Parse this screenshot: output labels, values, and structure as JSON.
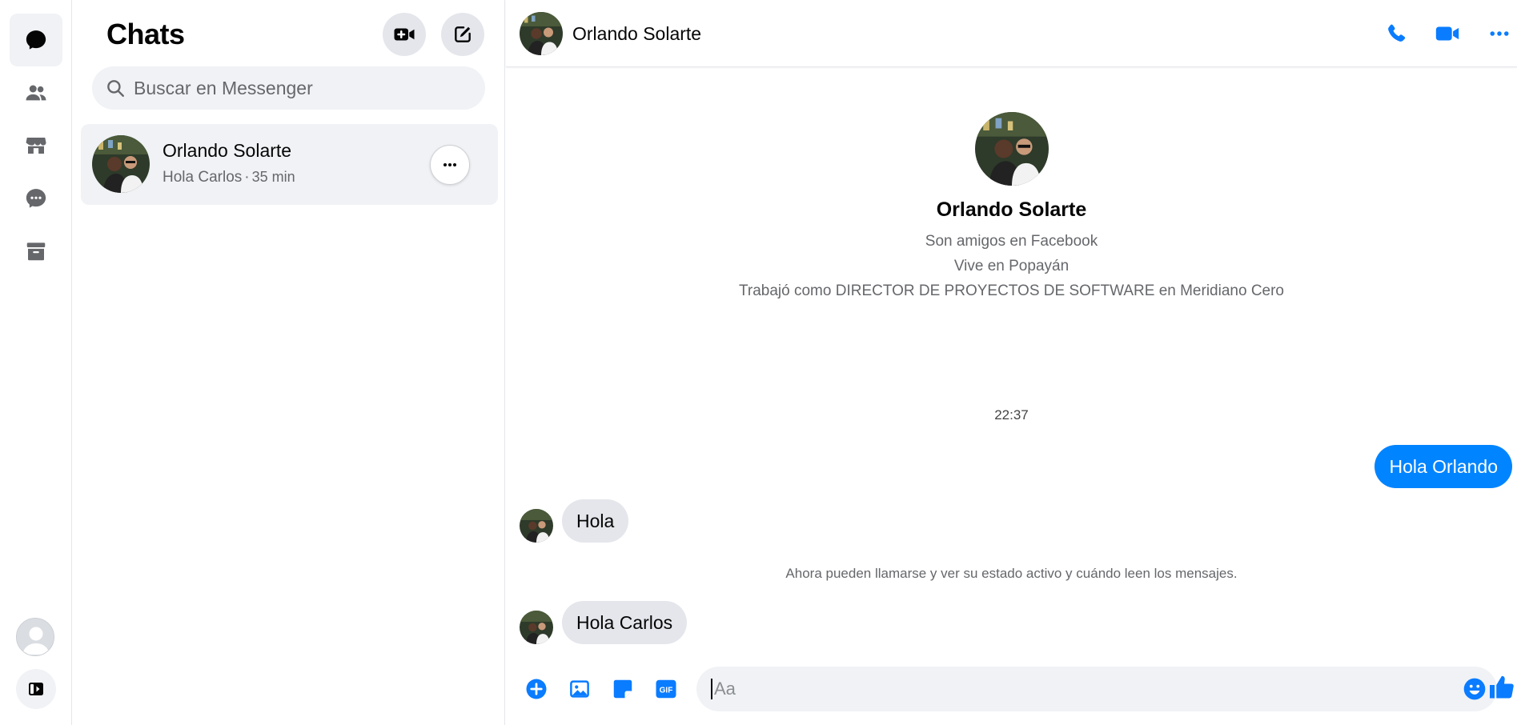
{
  "colors": {
    "accent": "#0084ff",
    "icon_blue": "#0a7cff",
    "bubble_in": "#e4e6eb",
    "surface": "#f0f2f5"
  },
  "rail": {
    "items": [
      {
        "name": "chats-icon",
        "active": true
      },
      {
        "name": "people-icon",
        "active": false
      },
      {
        "name": "marketplace-icon",
        "active": false
      },
      {
        "name": "requests-icon",
        "active": false
      },
      {
        "name": "archive-icon",
        "active": false
      }
    ]
  },
  "chat_list": {
    "title": "Chats",
    "search_placeholder": "Buscar en Messenger",
    "conversations": [
      {
        "name": "Orlando Solarte",
        "preview": "Hola Carlos",
        "separator": "·",
        "time": "35 min"
      }
    ]
  },
  "conversation": {
    "header_name": "Orlando Solarte",
    "profile": {
      "name": "Orlando Solarte",
      "line1": "Son amigos en Facebook",
      "line2": "Vive en Popayán",
      "line3": "Trabajó como DIRECTOR DE PROYECTOS DE SOFTWARE en Meridiano Cero"
    },
    "timestamp": "22:37",
    "messages": [
      {
        "direction": "out",
        "text": "Hola Orlando"
      },
      {
        "direction": "in",
        "text": "Hola"
      },
      {
        "direction": "system",
        "text": "Ahora pueden llamarse y ver su estado activo y cuándo leen los mensajes."
      },
      {
        "direction": "in",
        "text": "Hola Carlos"
      }
    ],
    "composer_placeholder": "Aa",
    "composer_icons": [
      "plus-icon",
      "photo-icon",
      "sticker-icon",
      "gif-icon",
      "emoji-icon",
      "like-icon"
    ]
  }
}
